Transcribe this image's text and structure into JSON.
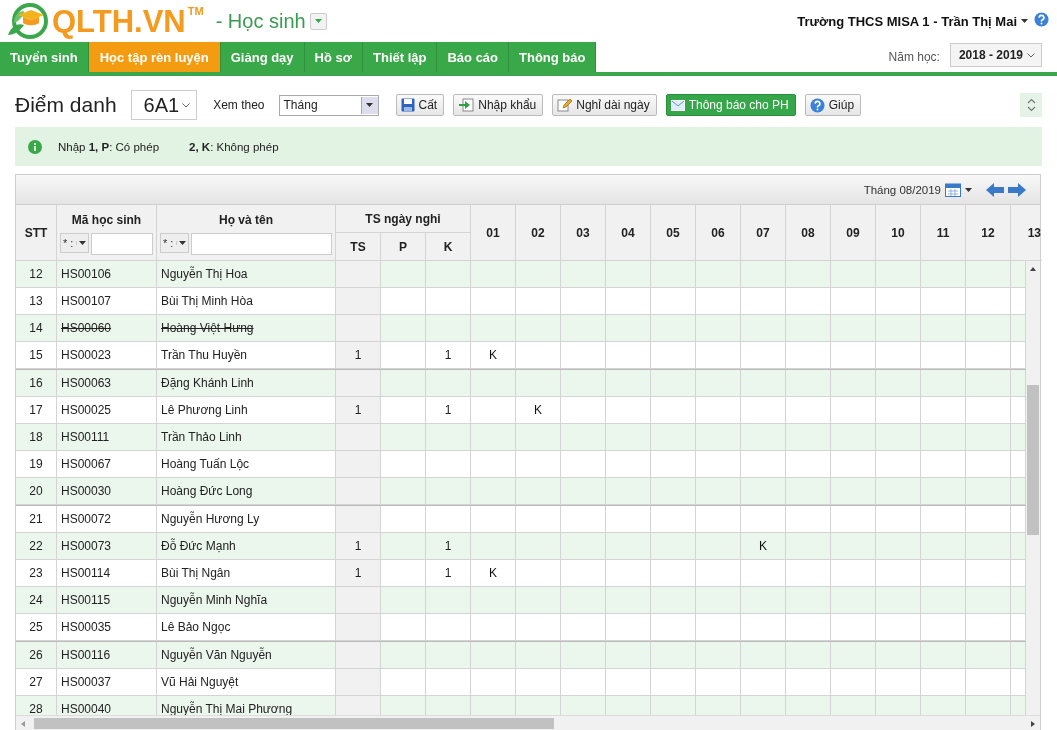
{
  "header": {
    "logo_text": "QLTH.VN",
    "trademark": "TM",
    "module": "- Học sinh",
    "user": "Trường THCS MISA 1 - Trần Thị Mai"
  },
  "nav": {
    "tabs": [
      {
        "label": "Tuyển sinh",
        "selected": false
      },
      {
        "label": "Học tập rèn luyện",
        "selected": true
      },
      {
        "label": "Giảng dạy",
        "selected": false
      },
      {
        "label": "Hồ sơ",
        "selected": false
      },
      {
        "label": "Thiết lập",
        "selected": false
      },
      {
        "label": "Báo cáo",
        "selected": false
      },
      {
        "label": "Thông báo",
        "selected": false
      }
    ],
    "year_label": "Năm học:",
    "year": "2018 - 2019"
  },
  "toolbar": {
    "title": "Điểm danh",
    "class": "6A1",
    "view_label": "Xem theo",
    "view": "Tháng",
    "buttons": [
      {
        "label": "Cất",
        "kind": "default"
      },
      {
        "label": "Nhập khẩu",
        "kind": "default"
      },
      {
        "label": "Nghỉ dài ngày",
        "kind": "default"
      },
      {
        "label": "Thông báo cho PH",
        "kind": "primary"
      },
      {
        "label": "Giúp",
        "kind": "default"
      }
    ]
  },
  "legend": [
    "Nhập  **1, P**: Có phép",
    "**2, K**: Không phép"
  ],
  "table": {
    "period": "Tháng 08/2019",
    "columns": {
      "stt": "STT",
      "code": "Mã học sinh",
      "name": "Họ và tên",
      "absence_group": "TS ngày nghỉ",
      "ts": "TS",
      "p": "P",
      "k": "K"
    },
    "filters": [
      {
        "operator": "* :"
      },
      {
        "operator": "* :"
      }
    ],
    "day_columns": [
      "01",
      "02",
      "03",
      "04",
      "05",
      "06",
      "07",
      "08",
      "09",
      "10",
      "11",
      "12",
      "13"
    ],
    "rows": [
      {
        "stt": "12",
        "code": "HS00106",
        "name": "Nguyễn Thị Hoa",
        "withdrawn": false
      },
      {
        "stt": "13",
        "code": "HS00107",
        "name": "Bùi Thị Minh Hòa",
        "withdrawn": false
      },
      {
        "stt": "14",
        "code": "HS00060",
        "name": "Hoàng Việt Hưng",
        "withdrawn": true
      },
      {
        "stt": "15",
        "code": "HS00023",
        "name": "Trần Thu Huyền",
        "ts": "1",
        "k": "1",
        "withdrawn": false,
        "days": [
          {
            "absent": true,
            "mark": "K"
          }
        ]
      },
      {
        "stt": "16",
        "code": "HS00063",
        "name": "Đặng Khánh Linh",
        "withdrawn": false
      },
      {
        "stt": "17",
        "code": "HS00025",
        "name": "Lê Phương Linh",
        "ts": "1",
        "k": "1",
        "withdrawn": false,
        "days": [
          {
            "absent": false
          },
          {
            "absent": true,
            "mark": "K"
          }
        ]
      },
      {
        "stt": "18",
        "code": "HS00111",
        "name": "Trần Thảo Linh",
        "withdrawn": false
      },
      {
        "stt": "19",
        "code": "HS00067",
        "name": "Hoàng Tuấn Lộc",
        "withdrawn": false
      },
      {
        "stt": "20",
        "code": "HS00030",
        "name": "Hoàng Đức Long",
        "withdrawn": false
      },
      {
        "stt": "21",
        "code": "HS00072",
        "name": "Nguyễn Hương Ly",
        "withdrawn": false
      },
      {
        "stt": "22",
        "code": "HS00073",
        "name": "Đỗ Đức Mạnh",
        "ts": "1",
        "k": "1",
        "withdrawn": false,
        "days": [
          {
            "absent": false
          },
          {
            "absent": false
          },
          {
            "absent": false
          },
          {
            "absent": false
          },
          {
            "absent": false
          },
          {
            "absent": false
          },
          {
            "absent": true,
            "mark": "K"
          }
        ]
      },
      {
        "stt": "23",
        "code": "HS00114",
        "name": "Bùi Thị Ngân",
        "ts": "1",
        "k": "1",
        "withdrawn": false,
        "days": [
          {
            "absent": true,
            "mark": "K"
          }
        ]
      },
      {
        "stt": "24",
        "code": "HS00115",
        "name": "Nguyễn Minh Nghĩa",
        "withdrawn": false
      },
      {
        "stt": "25",
        "code": "HS00035",
        "name": "Lê Bảo Ngọc",
        "withdrawn": false
      },
      {
        "stt": "26",
        "code": "HS00116",
        "name": "Nguyễn Văn Nguyễn",
        "withdrawn": false
      },
      {
        "stt": "27",
        "code": "HS00037",
        "name": "Vũ Hải Nguyệt",
        "withdrawn": false
      },
      {
        "stt": "28",
        "code": "HS00040",
        "name": "Nguyễn Thị Mai Phương",
        "withdrawn": false
      }
    ]
  }
}
